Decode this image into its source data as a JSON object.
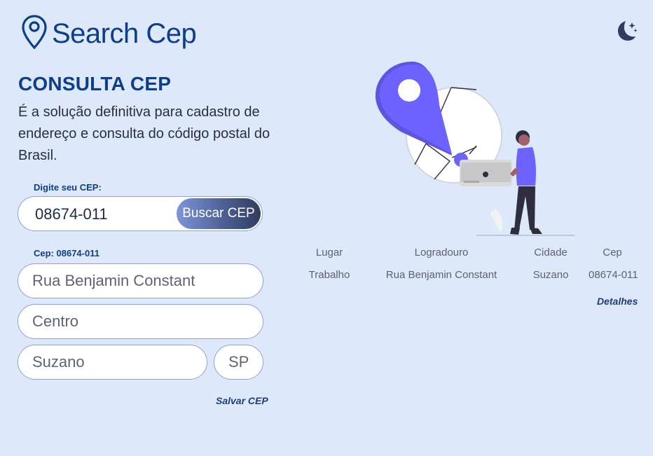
{
  "app": {
    "title": "Search Cep",
    "logo_icon": "map-pin-icon"
  },
  "theme_toggle": {
    "icon": "moon-stars-icon"
  },
  "hero": {
    "title": "CONSULTA CEP",
    "description": "É a solução definitiva para cadastro de endereço e consulta do código postal do Brasil."
  },
  "search": {
    "label": "Digite seu CEP:",
    "value": "08674-011",
    "button_label": "Buscar CEP"
  },
  "address_form": {
    "label": "Cep: 08674-011",
    "street": "Rua Benjamin Constant",
    "neighborhood": "Centro",
    "city": "Suzano",
    "state": "SP",
    "save_label": "Salvar CEP"
  },
  "results": {
    "headers": [
      "Lugar",
      "Logradouro",
      "Cidade",
      "Cep"
    ],
    "rows": [
      [
        "Trabalho",
        "Rua Benjamin Constant",
        "Suzano",
        "08674-011"
      ]
    ],
    "details_label": "Detalhes"
  },
  "colors": {
    "background": "#dee8fb",
    "brand": "#0c3e8c",
    "accent": "#6c63ff",
    "button_gradient_start": "#7d95d8",
    "button_gradient_end": "#2f3c5e"
  }
}
